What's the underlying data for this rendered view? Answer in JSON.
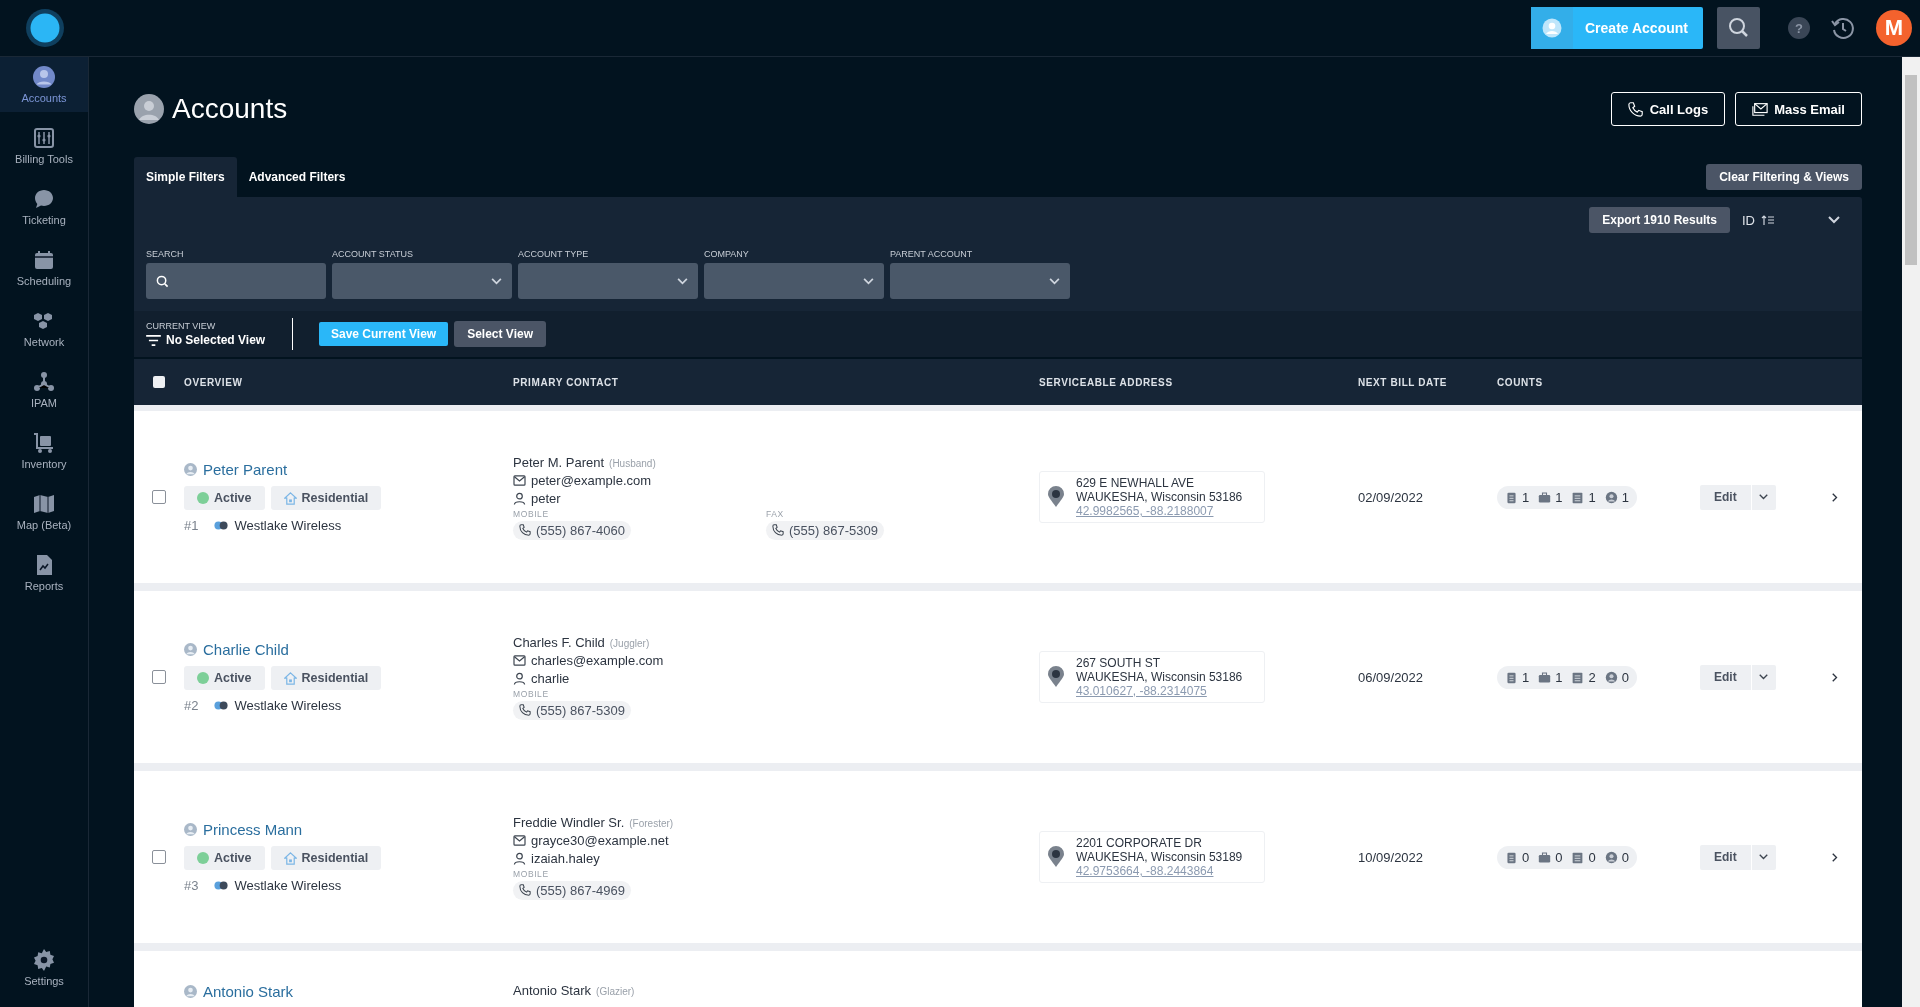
{
  "header": {
    "create_account": "Create Account",
    "avatar_initial": "M",
    "help": "?"
  },
  "sidebar": {
    "items": [
      {
        "label": "Accounts",
        "selected": true
      },
      {
        "label": "Billing Tools",
        "selected": false
      },
      {
        "label": "Ticketing",
        "selected": false
      },
      {
        "label": "Scheduling",
        "selected": false
      },
      {
        "label": "Network",
        "selected": false
      },
      {
        "label": "IPAM",
        "selected": false
      },
      {
        "label": "Inventory",
        "selected": false
      },
      {
        "label": "Map (Beta)",
        "selected": false
      },
      {
        "label": "Reports",
        "selected": false
      }
    ],
    "settings": "Settings"
  },
  "page": {
    "title": "Accounts",
    "actions": [
      "Call Logs",
      "Mass Email"
    ]
  },
  "tabs": [
    {
      "label": "Simple Filters",
      "selected": true
    },
    {
      "label": "Advanced Filters",
      "selected": false
    }
  ],
  "clear_button": "Clear Filtering & Views",
  "filters": {
    "export_button": "Export 1910 Results",
    "sort_label": "ID",
    "fields": [
      {
        "label": "SEARCH",
        "kind": "search"
      },
      {
        "label": "ACCOUNT STATUS",
        "kind": "select"
      },
      {
        "label": "ACCOUNT TYPE",
        "kind": "select"
      },
      {
        "label": "COMPANY",
        "kind": "select"
      },
      {
        "label": "PARENT ACCOUNT",
        "kind": "select"
      }
    ]
  },
  "current_view": {
    "label": "CURRENT VIEW",
    "value": "No Selected View",
    "buttons": [
      "Save Current View",
      "Select View"
    ]
  },
  "table": {
    "select_all_checked": false,
    "columns": [
      "OVERVIEW",
      "PRIMARY CONTACT",
      "SERVICEABLE ADDRESS",
      "NEXT BILL DATE",
      "COUNTS"
    ],
    "rows": [
      {
        "checked": false,
        "name": "Peter Parent",
        "status": "Active",
        "type": "Residential",
        "number": "#1",
        "company": "Westlake Wireless",
        "contact": {
          "name": "Peter M. Parent",
          "role": "(Husband)",
          "email": "peter@example.com",
          "username": "peter",
          "phones": [
            {
              "label": "MOBILE",
              "number": "(555) 867-4060"
            },
            {
              "label": "FAX",
              "number": "(555) 867-5309"
            }
          ]
        },
        "address": {
          "line1": "629 E NEWHALL AVE",
          "line2": "WAUKESHA, Wisconsin 53186",
          "coords": "42.9982565, -88.2188007"
        },
        "next_bill_date": "02/09/2022",
        "counts": [
          "1",
          "1",
          "1",
          "1"
        ],
        "edit": "Edit"
      },
      {
        "checked": false,
        "name": "Charlie Child",
        "status": "Active",
        "type": "Residential",
        "number": "#2",
        "company": "Westlake Wireless",
        "contact": {
          "name": "Charles F. Child",
          "role": "(Juggler)",
          "email": "charles@example.com",
          "username": "charlie",
          "phones": [
            {
              "label": "MOBILE",
              "number": "(555) 867-5309"
            }
          ]
        },
        "address": {
          "line1": "267 SOUTH ST",
          "line2": "WAUKESHA, Wisconsin 53186",
          "coords": "43.010627, -88.2314075"
        },
        "next_bill_date": "06/09/2022",
        "counts": [
          "1",
          "1",
          "2",
          "0"
        ],
        "edit": "Edit"
      },
      {
        "checked": false,
        "name": "Princess Mann",
        "status": "Active",
        "type": "Residential",
        "number": "#3",
        "company": "Westlake Wireless",
        "contact": {
          "name": "Freddie Windler Sr.",
          "role": "(Forester)",
          "email": "grayce30@example.net",
          "username": "izaiah.haley",
          "phones": [
            {
              "label": "MOBILE",
              "number": "(555) 867-4969"
            }
          ]
        },
        "address": {
          "line1": "2201 CORPORATE DR",
          "line2": "WAUKESHA, Wisconsin 53189",
          "coords": "42.9753664, -88.2443864"
        },
        "next_bill_date": "10/09/2022",
        "counts": [
          "0",
          "0",
          "0",
          "0"
        ],
        "edit": "Edit"
      },
      {
        "name": "Antonio Stark",
        "contact": {
          "name": "Antonio Stark",
          "role": "(Glazier)"
        }
      }
    ]
  }
}
